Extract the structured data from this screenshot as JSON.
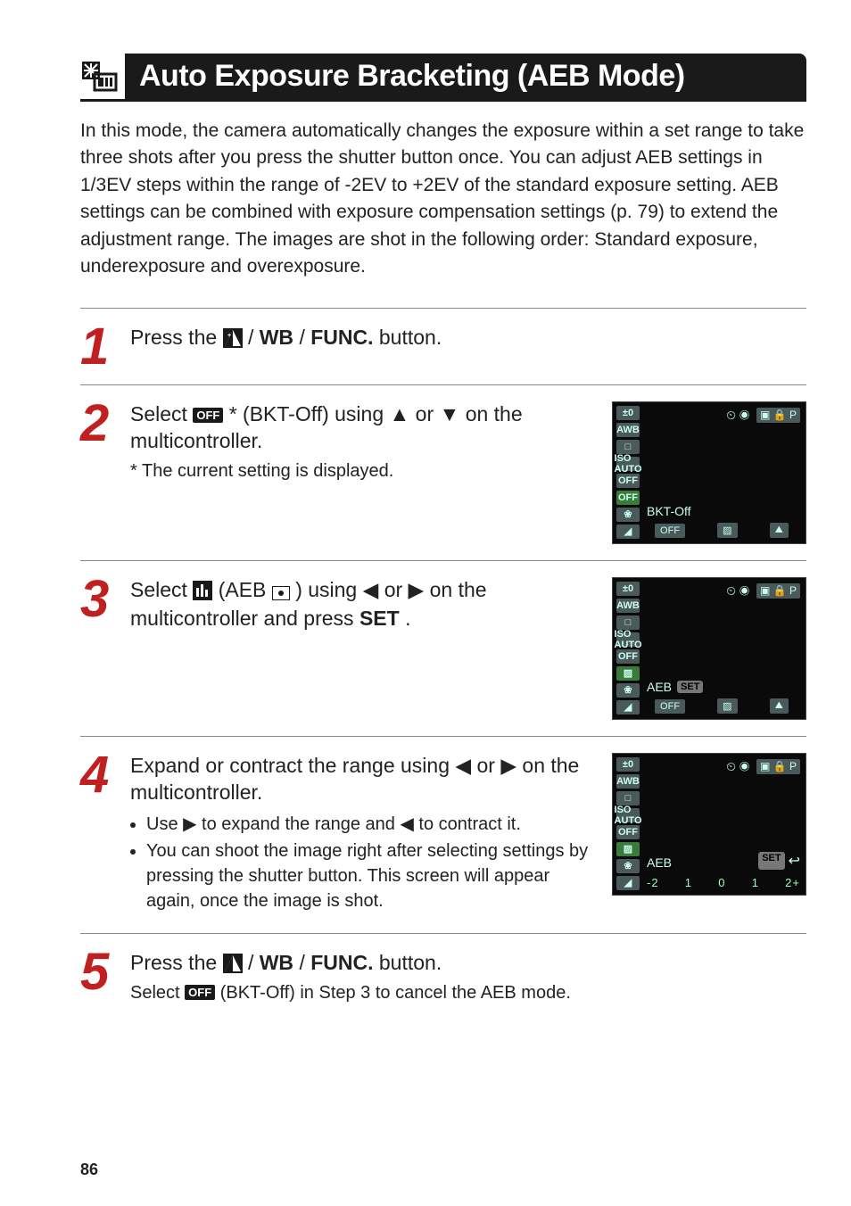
{
  "title": {
    "icon_name": "aeb-mode-icon",
    "text": "Auto Exposure Bracketing (AEB Mode)"
  },
  "intro": "In this mode, the camera automatically changes the exposure within a set range to take three shots after you press the shutter button once. You can adjust AEB settings in 1/3EV steps within the range of -2EV to +2EV of the standard exposure setting. AEB settings can be combined with exposure compensation settings (p. 79) to extend the adjustment range. The images are shot in the following order: Standard exposure, underexposure and overexposure.",
  "steps": [
    {
      "num": "1",
      "head_prefix": "Press the ",
      "button_label": "FUNC.",
      "head_suffix": " button."
    },
    {
      "num": "2",
      "head_prefix": "Select ",
      "bktoff_label": "* (BKT-Off) using ",
      "arrows": "▲ or ▼",
      "head_suffix": " on the multicontroller.",
      "sub": "* The current setting is displayed.",
      "lcd": {
        "col": [
          "±0",
          "AWB",
          "□",
          "ISO AUTO",
          "OFF",
          "OFF",
          "❀",
          "◢"
        ],
        "hl_index": 5,
        "top_timer": "⏲ ◉",
        "top_right": "▣ 🔒 P",
        "label": "BKT-Off",
        "show_set": false,
        "bot": [
          "OFF",
          "▨",
          "⛰"
        ]
      }
    },
    {
      "num": "3",
      "head_prefix": "Select ",
      "aeb_label": " (AEB",
      "aeb_label2": ") using ",
      "arrows": "◀ or ▶",
      "head_suffix": " on the multicontroller and press ",
      "set_label": "SET",
      "head_end": ".",
      "lcd": {
        "col": [
          "±0",
          "AWB",
          "□",
          "ISO AUTO",
          "OFF",
          "▨",
          "❀",
          "◢"
        ],
        "hl_index": 5,
        "top_timer": "⏲ ◉",
        "top_right": "▣ 🔒 P",
        "label": "AEB",
        "show_set": true,
        "bot": [
          "OFF",
          "▨",
          "⛰"
        ]
      }
    },
    {
      "num": "4",
      "head_prefix": "Expand or contract the range using ",
      "arrows": "◀ or ▶",
      "head_suffix": " on the multicontroller.",
      "bullets": [
        "Use ▶ to expand the range and ◀ to contract it.",
        "You can shoot the image right after selecting settings by pressing the shutter button.  This screen will appear again, once the image is shot."
      ],
      "lcd": {
        "col": [
          "±0",
          "AWB",
          "□",
          "ISO AUTO",
          "OFF",
          "▨",
          "❀",
          "◢"
        ],
        "hl_index": 5,
        "top_timer": "⏲ ◉",
        "top_right": "▣ 🔒 P",
        "label": "AEB",
        "show_set_return": true,
        "scale": [
          "-2",
          "1",
          "0",
          "1",
          "2+"
        ]
      }
    },
    {
      "num": "5",
      "head_prefix": "Press the ",
      "button_label": "FUNC.",
      "head_suffix": " button.",
      "sub": "Select  (BKT-Off) in Step 3 to cancel the AEB mode.",
      "sub_icon_name": "bkt-off-icon"
    }
  ],
  "func_parts": {
    "ev": "±",
    "wb": "WB",
    "func": "FUNC."
  },
  "page_number": "86"
}
